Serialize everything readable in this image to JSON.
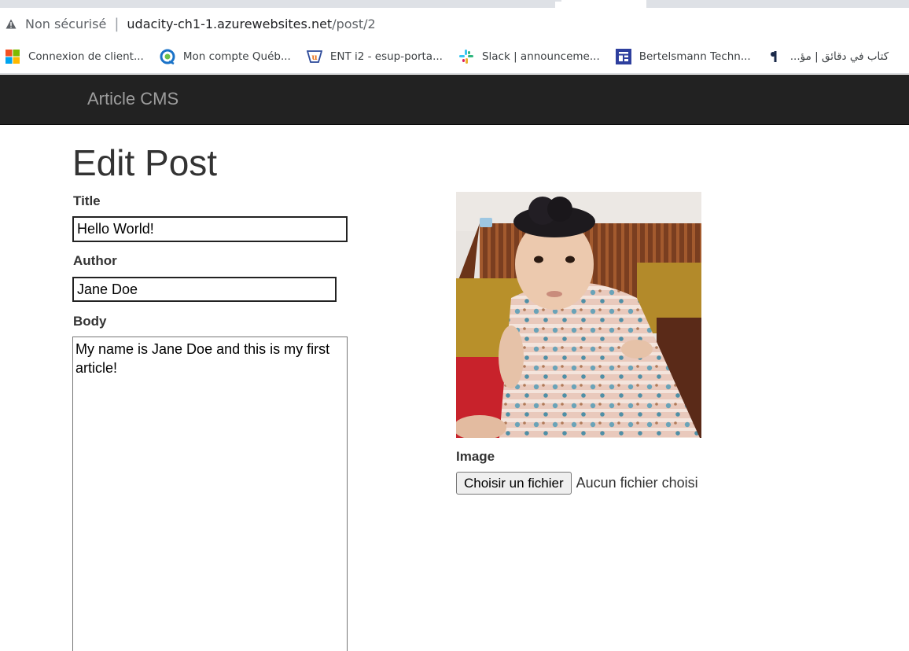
{
  "browser": {
    "security_label": "Non sécurisé",
    "separator": "|",
    "url_host": "udacity-ch1-1.azurewebsites.net",
    "url_path": "/post/2"
  },
  "bookmarks": [
    {
      "label": "Connexion de client...",
      "icon": "microsoft-icon"
    },
    {
      "label": "Mon compte Québ...",
      "icon": "quebec-icon"
    },
    {
      "label": "ENT i2 - esup-porta...",
      "icon": "ent-icon"
    },
    {
      "label": "Slack | announceme...",
      "icon": "slack-icon"
    },
    {
      "label": "Bertelsmann Techn...",
      "icon": "bertelsmann-icon"
    },
    {
      "label": "كتاب في دقائق | مؤ...",
      "icon": "kitab-icon"
    }
  ],
  "site": {
    "brand": "Article CMS"
  },
  "form": {
    "heading": "Edit Post",
    "title_label": "Title",
    "title_value": "Hello World!",
    "author_label": "Author",
    "author_value": "Jane Doe",
    "body_label": "Body",
    "body_value": "My name is Jane Doe and this is my first article!",
    "image_label": "Image",
    "file_button": "Choisir un fichier",
    "file_status": "Aucun fichier choisi"
  },
  "colors": {
    "navbar": "#222222",
    "brand_text": "#9d9d9d"
  }
}
